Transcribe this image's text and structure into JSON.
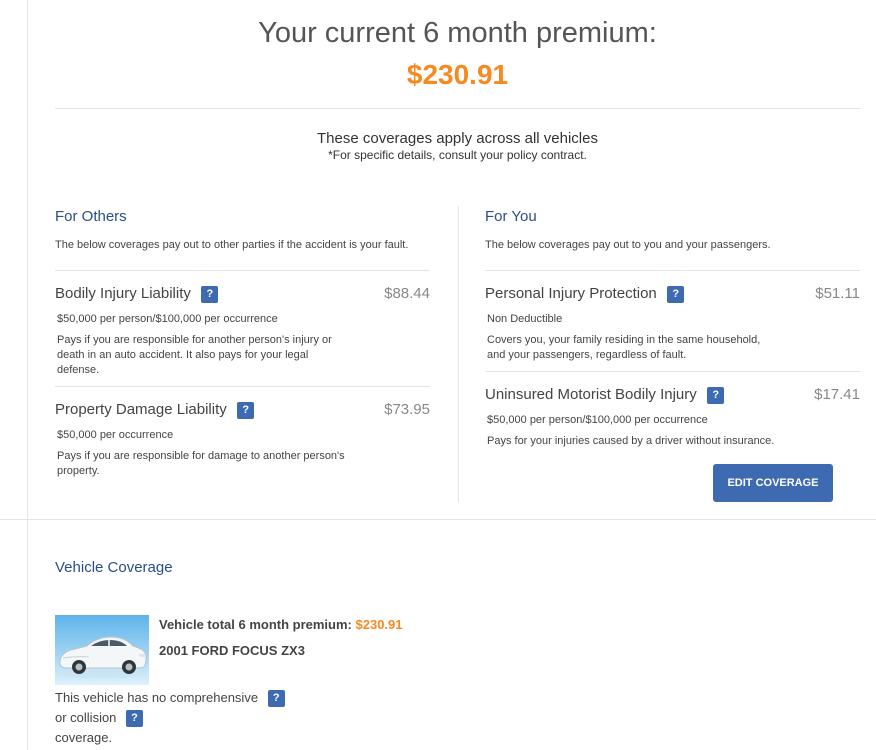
{
  "premium": {
    "title": "Your current 6 month premium:",
    "amount": "$230.91"
  },
  "applies": {
    "main": "These coverages apply across all vehicles",
    "note": "*For specific details, consult your policy contract."
  },
  "help_label": "?",
  "for_others": {
    "title": "For Others",
    "description": "The below coverages pay out to other parties if the accident is your fault.",
    "coverages": [
      {
        "name": "Bodily Injury Liability",
        "price": "$88.44",
        "limit": "$50,000 per person/$100,000 per occurrence",
        "text": "Pays if you are responsible for another person's injury or death in an auto accident. It also pays for your legal defense."
      },
      {
        "name": "Property Damage Liability",
        "price": "$73.95",
        "limit": "$50,000 per occurrence",
        "text": "Pays if you are responsible for damage to another person's property."
      }
    ]
  },
  "for_you": {
    "title": "For You",
    "description": "The below coverages pay out to you and your passengers.",
    "coverages": [
      {
        "name": "Personal Injury Protection",
        "price": "$51.11",
        "limit": "Non Deductible",
        "text": "Covers you, your family residing in the same household, and your passengers, regardless of fault."
      },
      {
        "name": "Uninsured Motorist Bodily Injury",
        "price": "$17.41",
        "limit": "$50,000 per person/$100,000 per occurrence",
        "text": "Pays for your injuries caused by a driver without insurance."
      }
    ]
  },
  "edit_button_label": "EDIT COVERAGE",
  "vehicle_coverage": {
    "title": "Vehicle Coverage",
    "total_label": "Vehicle total 6 month premium:",
    "total_amount": "$230.91",
    "vehicle_name": "2001 FORD FOCUS ZX3",
    "no_comp_line1": "This vehicle has no comprehensive",
    "no_comp_line2": "or collision",
    "no_comp_line3": "coverage."
  },
  "colors": {
    "accent_orange": "#f7891f",
    "heading_blue": "#2a4d8c",
    "button_blue": "#3e6ab2"
  }
}
